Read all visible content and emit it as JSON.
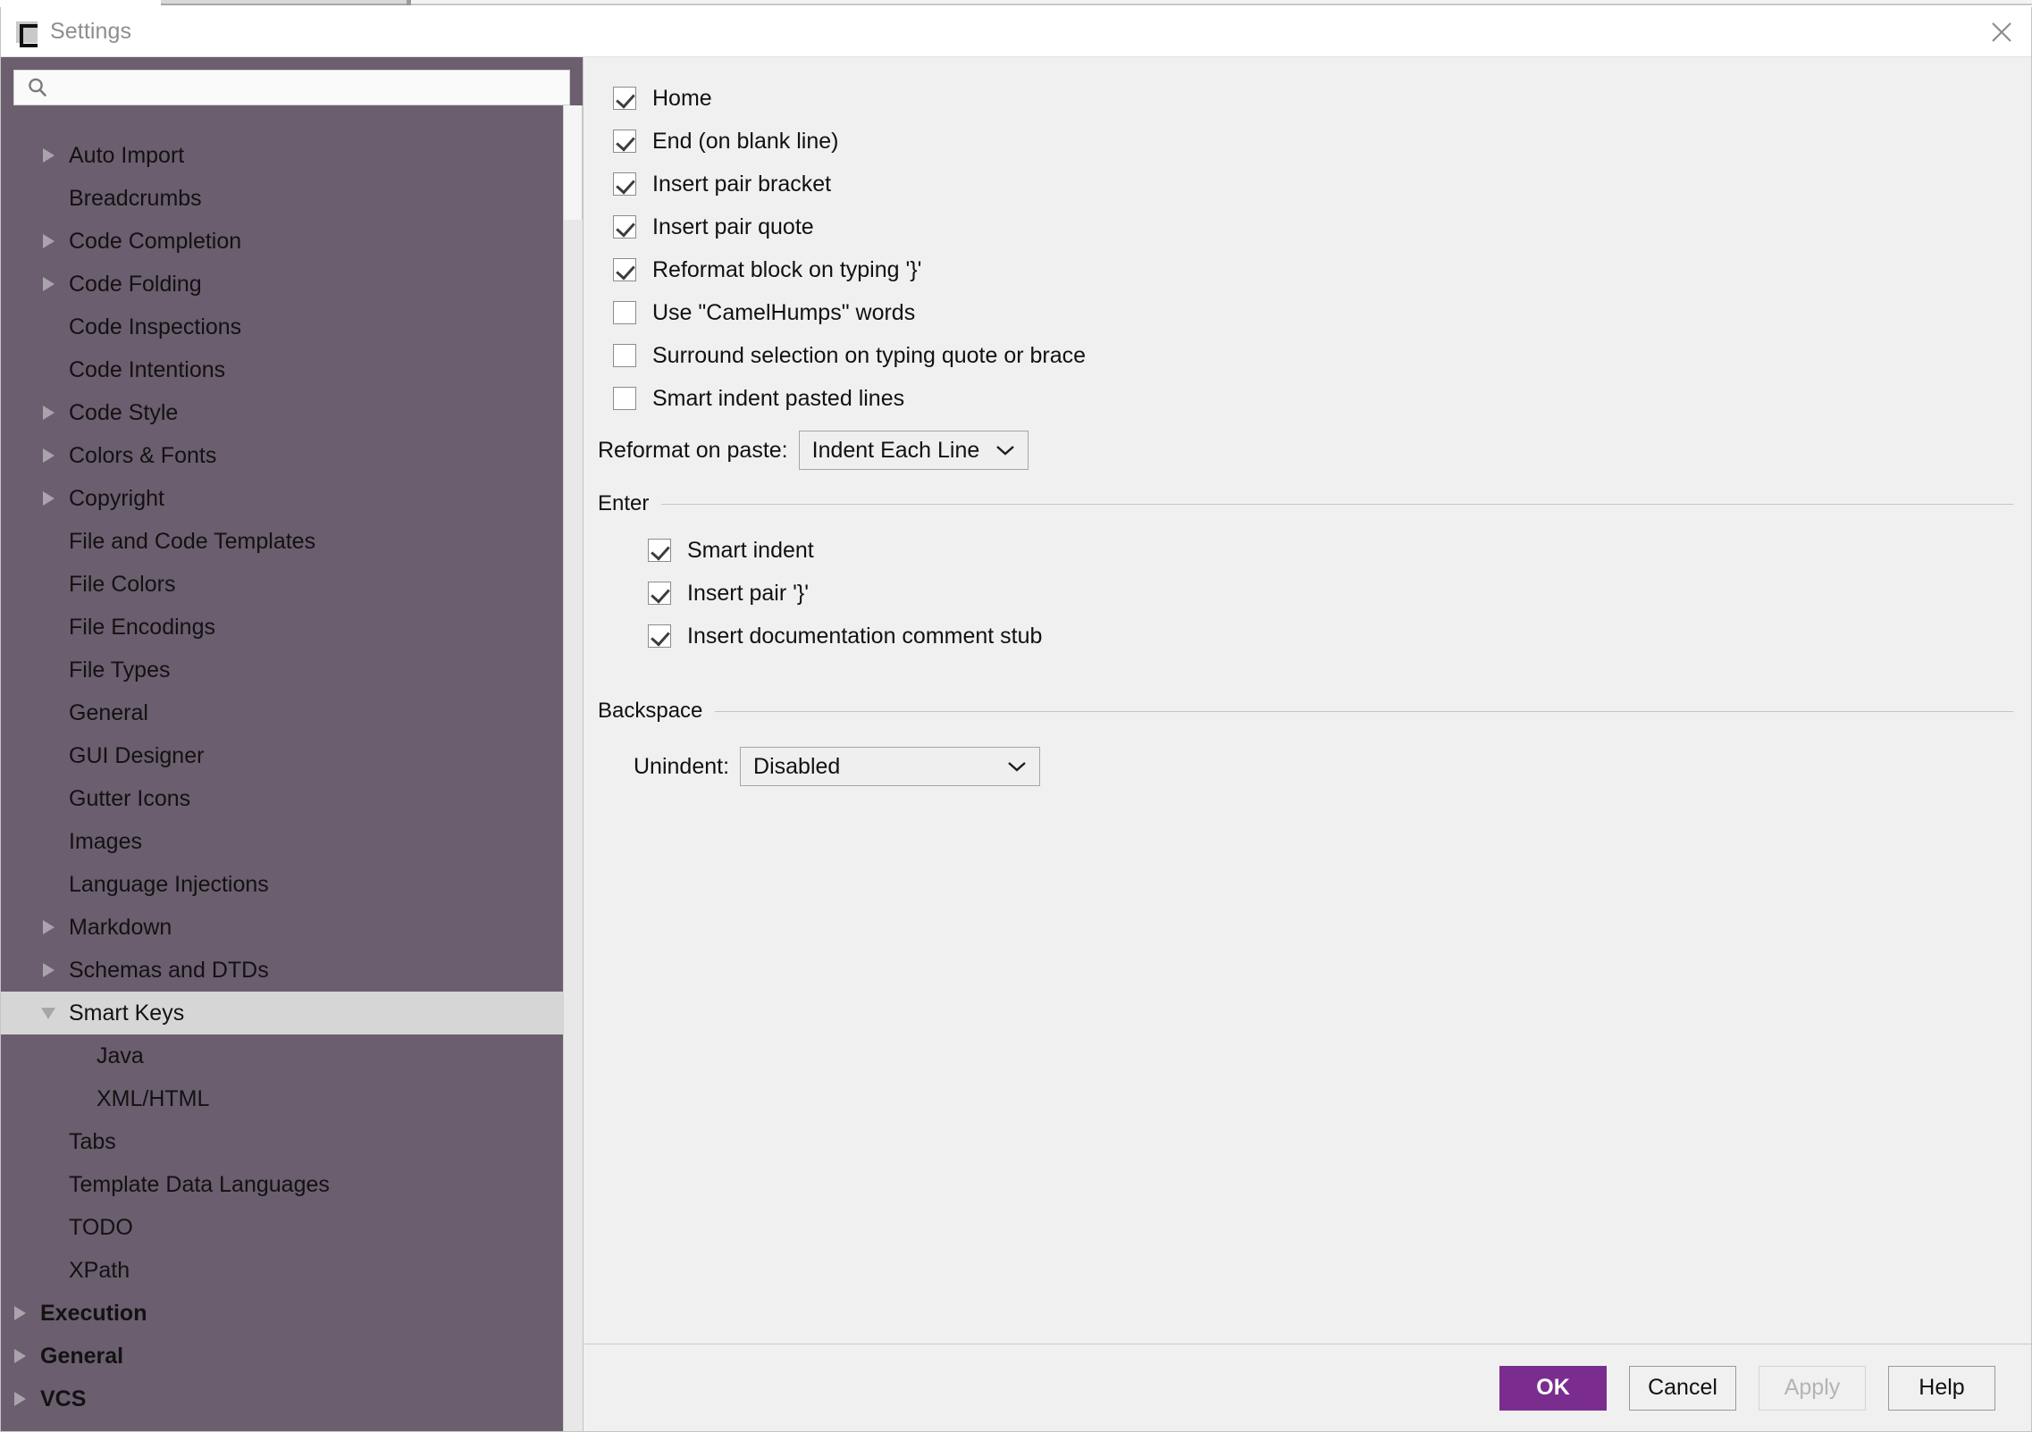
{
  "window": {
    "title": "Settings",
    "app_icon": "intellij-settings-icon",
    "close_icon": "close-icon"
  },
  "sidebar": {
    "search": {
      "value": "",
      "placeholder": "",
      "icon": "search-icon"
    },
    "tree": [
      {
        "label": "..",
        "level": 1,
        "arrow": "none",
        "bold": false,
        "selected": false,
        "partial": true
      },
      {
        "label": "Auto Import",
        "level": 1,
        "arrow": "right",
        "bold": false,
        "selected": false
      },
      {
        "label": "Breadcrumbs",
        "level": 1,
        "arrow": "none",
        "bold": false,
        "selected": false
      },
      {
        "label": "Code Completion",
        "level": 1,
        "arrow": "right",
        "bold": false,
        "selected": false
      },
      {
        "label": "Code Folding",
        "level": 1,
        "arrow": "right",
        "bold": false,
        "selected": false
      },
      {
        "label": "Code Inspections",
        "level": 1,
        "arrow": "none",
        "bold": false,
        "selected": false
      },
      {
        "label": "Code Intentions",
        "level": 1,
        "arrow": "none",
        "bold": false,
        "selected": false
      },
      {
        "label": "Code Style",
        "level": 1,
        "arrow": "right",
        "bold": false,
        "selected": false
      },
      {
        "label": "Colors & Fonts",
        "level": 1,
        "arrow": "right",
        "bold": false,
        "selected": false
      },
      {
        "label": "Copyright",
        "level": 1,
        "arrow": "right",
        "bold": false,
        "selected": false
      },
      {
        "label": "File and Code Templates",
        "level": 1,
        "arrow": "none",
        "bold": false,
        "selected": false
      },
      {
        "label": "File Colors",
        "level": 1,
        "arrow": "none",
        "bold": false,
        "selected": false
      },
      {
        "label": "File Encodings",
        "level": 1,
        "arrow": "none",
        "bold": false,
        "selected": false
      },
      {
        "label": "File Types",
        "level": 1,
        "arrow": "none",
        "bold": false,
        "selected": false
      },
      {
        "label": "General",
        "level": 1,
        "arrow": "none",
        "bold": false,
        "selected": false
      },
      {
        "label": "GUI Designer",
        "level": 1,
        "arrow": "none",
        "bold": false,
        "selected": false
      },
      {
        "label": "Gutter Icons",
        "level": 1,
        "arrow": "none",
        "bold": false,
        "selected": false
      },
      {
        "label": "Images",
        "level": 1,
        "arrow": "none",
        "bold": false,
        "selected": false
      },
      {
        "label": "Language Injections",
        "level": 1,
        "arrow": "none",
        "bold": false,
        "selected": false
      },
      {
        "label": "Markdown",
        "level": 1,
        "arrow": "right",
        "bold": false,
        "selected": false
      },
      {
        "label": "Schemas and DTDs",
        "level": 1,
        "arrow": "right",
        "bold": false,
        "selected": false
      },
      {
        "label": "Smart Keys",
        "level": 1,
        "arrow": "down",
        "bold": false,
        "selected": true
      },
      {
        "label": "Java",
        "level": 2,
        "arrow": "none",
        "bold": false,
        "selected": false
      },
      {
        "label": "XML/HTML",
        "level": 2,
        "arrow": "none",
        "bold": false,
        "selected": false
      },
      {
        "label": "Tabs",
        "level": 1,
        "arrow": "none",
        "bold": false,
        "selected": false
      },
      {
        "label": "Template Data Languages",
        "level": 1,
        "arrow": "none",
        "bold": false,
        "selected": false
      },
      {
        "label": "TODO",
        "level": 1,
        "arrow": "none",
        "bold": false,
        "selected": false
      },
      {
        "label": "XPath",
        "level": 1,
        "arrow": "none",
        "bold": false,
        "selected": false
      },
      {
        "label": "Execution",
        "level": 0,
        "arrow": "right",
        "bold": true,
        "selected": false
      },
      {
        "label": "General",
        "level": 0,
        "arrow": "right",
        "bold": true,
        "selected": false
      },
      {
        "label": "VCS",
        "level": 0,
        "arrow": "right",
        "bold": true,
        "selected": false
      }
    ]
  },
  "content": {
    "checkboxes": [
      {
        "label": "Home",
        "checked": true
      },
      {
        "label": "End (on blank line)",
        "checked": true
      },
      {
        "label": "Insert pair bracket",
        "checked": true
      },
      {
        "label": "Insert pair quote",
        "checked": true
      },
      {
        "label": "Reformat block on typing '}'",
        "checked": true
      },
      {
        "label": "Use \"CamelHumps\" words",
        "checked": false
      },
      {
        "label": "Surround selection on typing quote or brace",
        "checked": false
      },
      {
        "label": "Smart indent pasted lines",
        "checked": false
      }
    ],
    "reformat_on_paste": {
      "caption": "Reformat on paste:",
      "value": "Indent Each Line",
      "chevron_icon": "chevron-down-icon"
    },
    "enter_group": {
      "title": "Enter",
      "checkboxes": [
        {
          "label": "Smart indent",
          "checked": true
        },
        {
          "label": "Insert pair '}'",
          "checked": true
        },
        {
          "label": "Insert documentation comment stub",
          "checked": true
        }
      ]
    },
    "backspace_group": {
      "title": "Backspace",
      "unindent": {
        "caption": "Unindent:",
        "value": "Disabled",
        "chevron_icon": "chevron-down-icon"
      }
    }
  },
  "buttons": {
    "ok": "OK",
    "cancel": "Cancel",
    "apply": "Apply",
    "help": "Help"
  },
  "colors": {
    "sidebar_bg": "#6b5e6e",
    "selection_bg": "#d6d6d6",
    "panel_bg": "#f0f0f0",
    "accent": "#7b2c8f",
    "titlebar_bg": "#ffffff"
  }
}
